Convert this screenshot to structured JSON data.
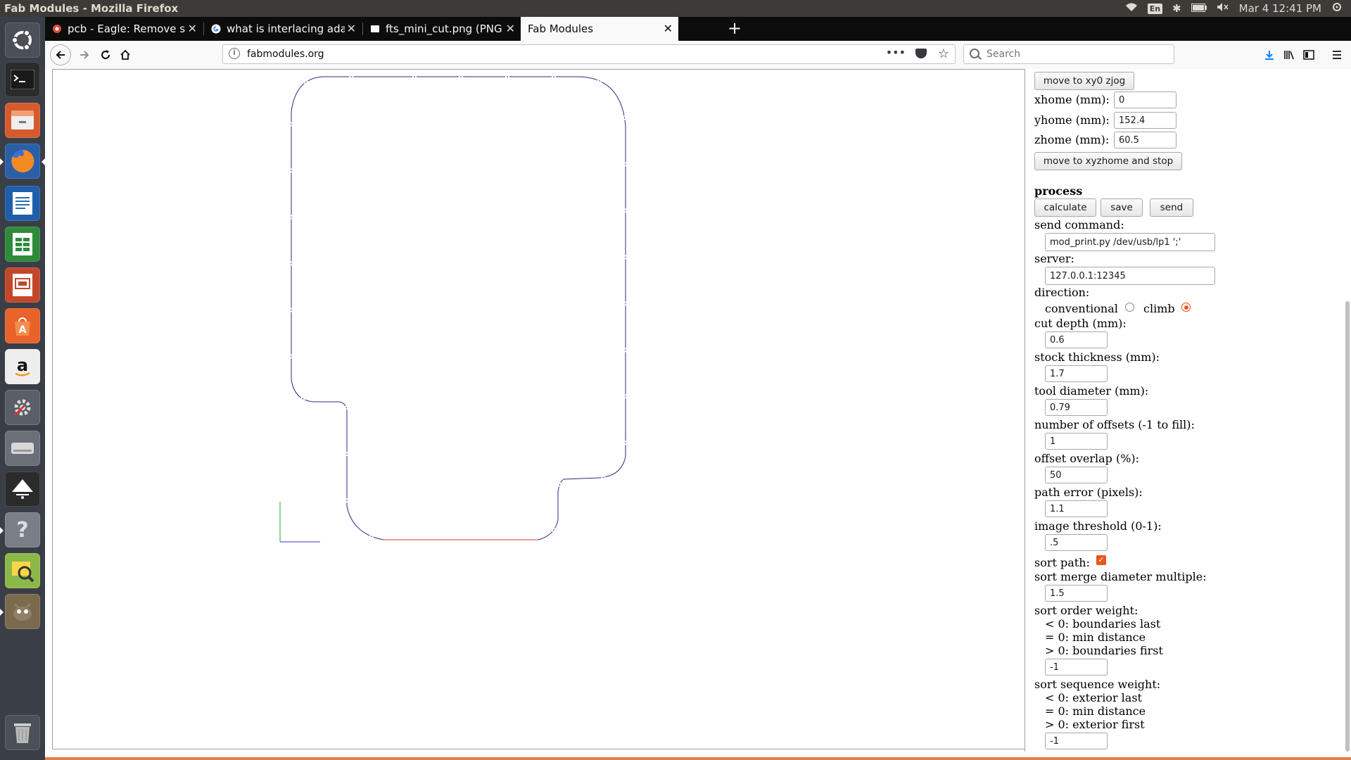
{
  "system": {
    "window_title": "Fab Modules - Mozilla Firefox",
    "lang": "En",
    "datetime": "Mar 4 12:41 PM"
  },
  "tabs": [
    {
      "title": "pcb - Eagle: Remove som",
      "icon": "eagle-favicon"
    },
    {
      "title": "what is interlacing adam",
      "icon": "google-favicon"
    },
    {
      "title": "fts_mini_cut.png (PNG I",
      "icon": "image-favicon"
    },
    {
      "title": "Fab Modules",
      "icon": "none"
    }
  ],
  "nav": {
    "url": "fabmodules.org",
    "search_placeholder": "Search"
  },
  "panel": {
    "move_xy0_zjog": "move to xy0 zjog",
    "xhome_label": "xhome (mm):",
    "xhome": "0",
    "yhome_label": "yhome (mm):",
    "yhome": "152.4",
    "zhome_label": "zhome (mm):",
    "zhome": "60.5",
    "move_xyzhome_stop": "move to xyzhome and stop",
    "process_heading": "process",
    "calculate": "calculate",
    "save": "save",
    "send": "send",
    "send_command_label": "send command:",
    "send_command": "mod_print.py /dev/usb/lp1 ';'",
    "server_label": "server:",
    "server": "127.0.0.1:12345",
    "direction_label": "direction:",
    "conventional_label": "conventional",
    "climb_label": "climb",
    "direction_selected": "climb",
    "cut_depth_label": "cut depth (mm):",
    "cut_depth": "0.6",
    "stock_thickness_label": "stock thickness (mm):",
    "stock_thickness": "1.7",
    "tool_diameter_label": "tool diameter (mm):",
    "tool_diameter": "0.79",
    "offsets_label": "number of offsets (-1 to fill):",
    "offsets": "1",
    "offset_overlap_label": "offset overlap (%):",
    "offset_overlap": "50",
    "path_error_label": "path error (pixels):",
    "path_error": "1.1",
    "image_threshold_label": "image threshold (0-1):",
    "image_threshold": ".5",
    "sort_path_label": "sort path:",
    "sort_path_checked": true,
    "sort_merge_label": "sort merge diameter multiple:",
    "sort_merge": "1.5",
    "sort_order_label": "sort order weight:",
    "sort_order_lines": [
      "< 0: boundaries last",
      "= 0: min distance",
      "> 0: boundaries first"
    ],
    "sort_order": "-1",
    "sort_sequence_label": "sort sequence weight:",
    "sort_sequence_lines": [
      "< 0: exterior last",
      "= 0: min distance",
      "> 0: exterior first"
    ],
    "sort_sequence": "-1"
  },
  "colors": {
    "accent": "#e8561e",
    "path": "#2b2b80",
    "path_red": "#e03030",
    "axis_green": "#22aa22",
    "axis_blue": "#3333cc"
  }
}
